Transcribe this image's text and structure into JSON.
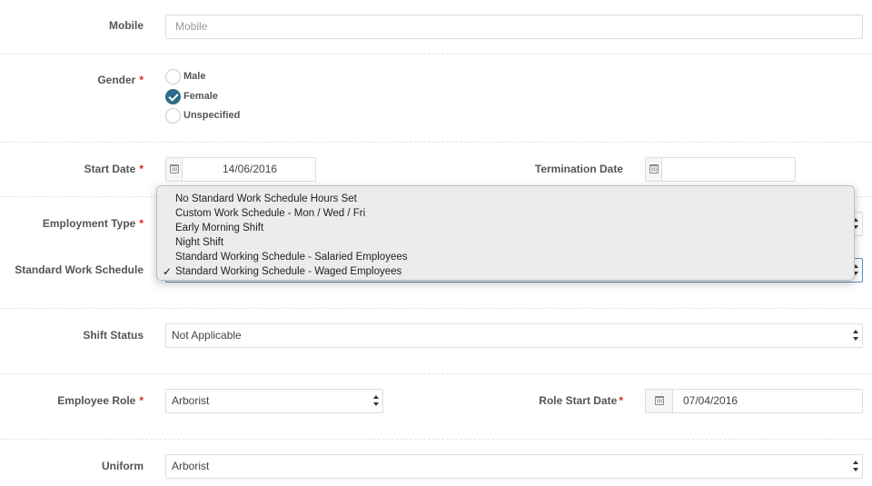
{
  "form": {
    "mobile": {
      "label": "Mobile",
      "placeholder": "Mobile",
      "value": ""
    },
    "gender": {
      "label": "Gender",
      "required_mark": "*",
      "options": [
        {
          "label": "Male",
          "checked": false
        },
        {
          "label": "Female",
          "checked": true
        },
        {
          "label": "Unspecified",
          "checked": false
        }
      ]
    },
    "start_date": {
      "label": "Start Date",
      "required_mark": "*",
      "value": "14/06/2016"
    },
    "termination_date": {
      "label": "Termination Date",
      "value": ""
    },
    "employment_type": {
      "label": "Employment Type",
      "required_mark": "*"
    },
    "standard_work_schedule": {
      "label": "Standard Work Schedule",
      "selected": "Standard Working Schedule - Waged Employees",
      "dropdown_open": true,
      "options": [
        "No Standard Work Schedule Hours Set",
        "Custom Work Schedule - Mon / Wed / Fri",
        "Early Morning Shift",
        "Night Shift",
        "Standard Working Schedule - Salaried Employees",
        "Standard Working Schedule - Waged Employees"
      ],
      "checkmark": "✓"
    },
    "shift_status": {
      "label": "Shift Status",
      "value": "Not Applicable"
    },
    "employee_role": {
      "label": "Employee Role",
      "required_mark": "*",
      "value": "Arborist"
    },
    "role_start_date": {
      "label": "Role Start Date",
      "required_mark": "*",
      "value": "07/04/2016"
    },
    "uniform": {
      "label": "Uniform",
      "value": "Arborist"
    }
  },
  "icons": {
    "calendar": "calendar-icon",
    "select_arrows": "updown-arrows-icon",
    "radio_check": "check-icon"
  },
  "colors": {
    "required": "#e02424",
    "radio_checked": "#2c6a87",
    "focus_border": "#5b8fc7"
  }
}
